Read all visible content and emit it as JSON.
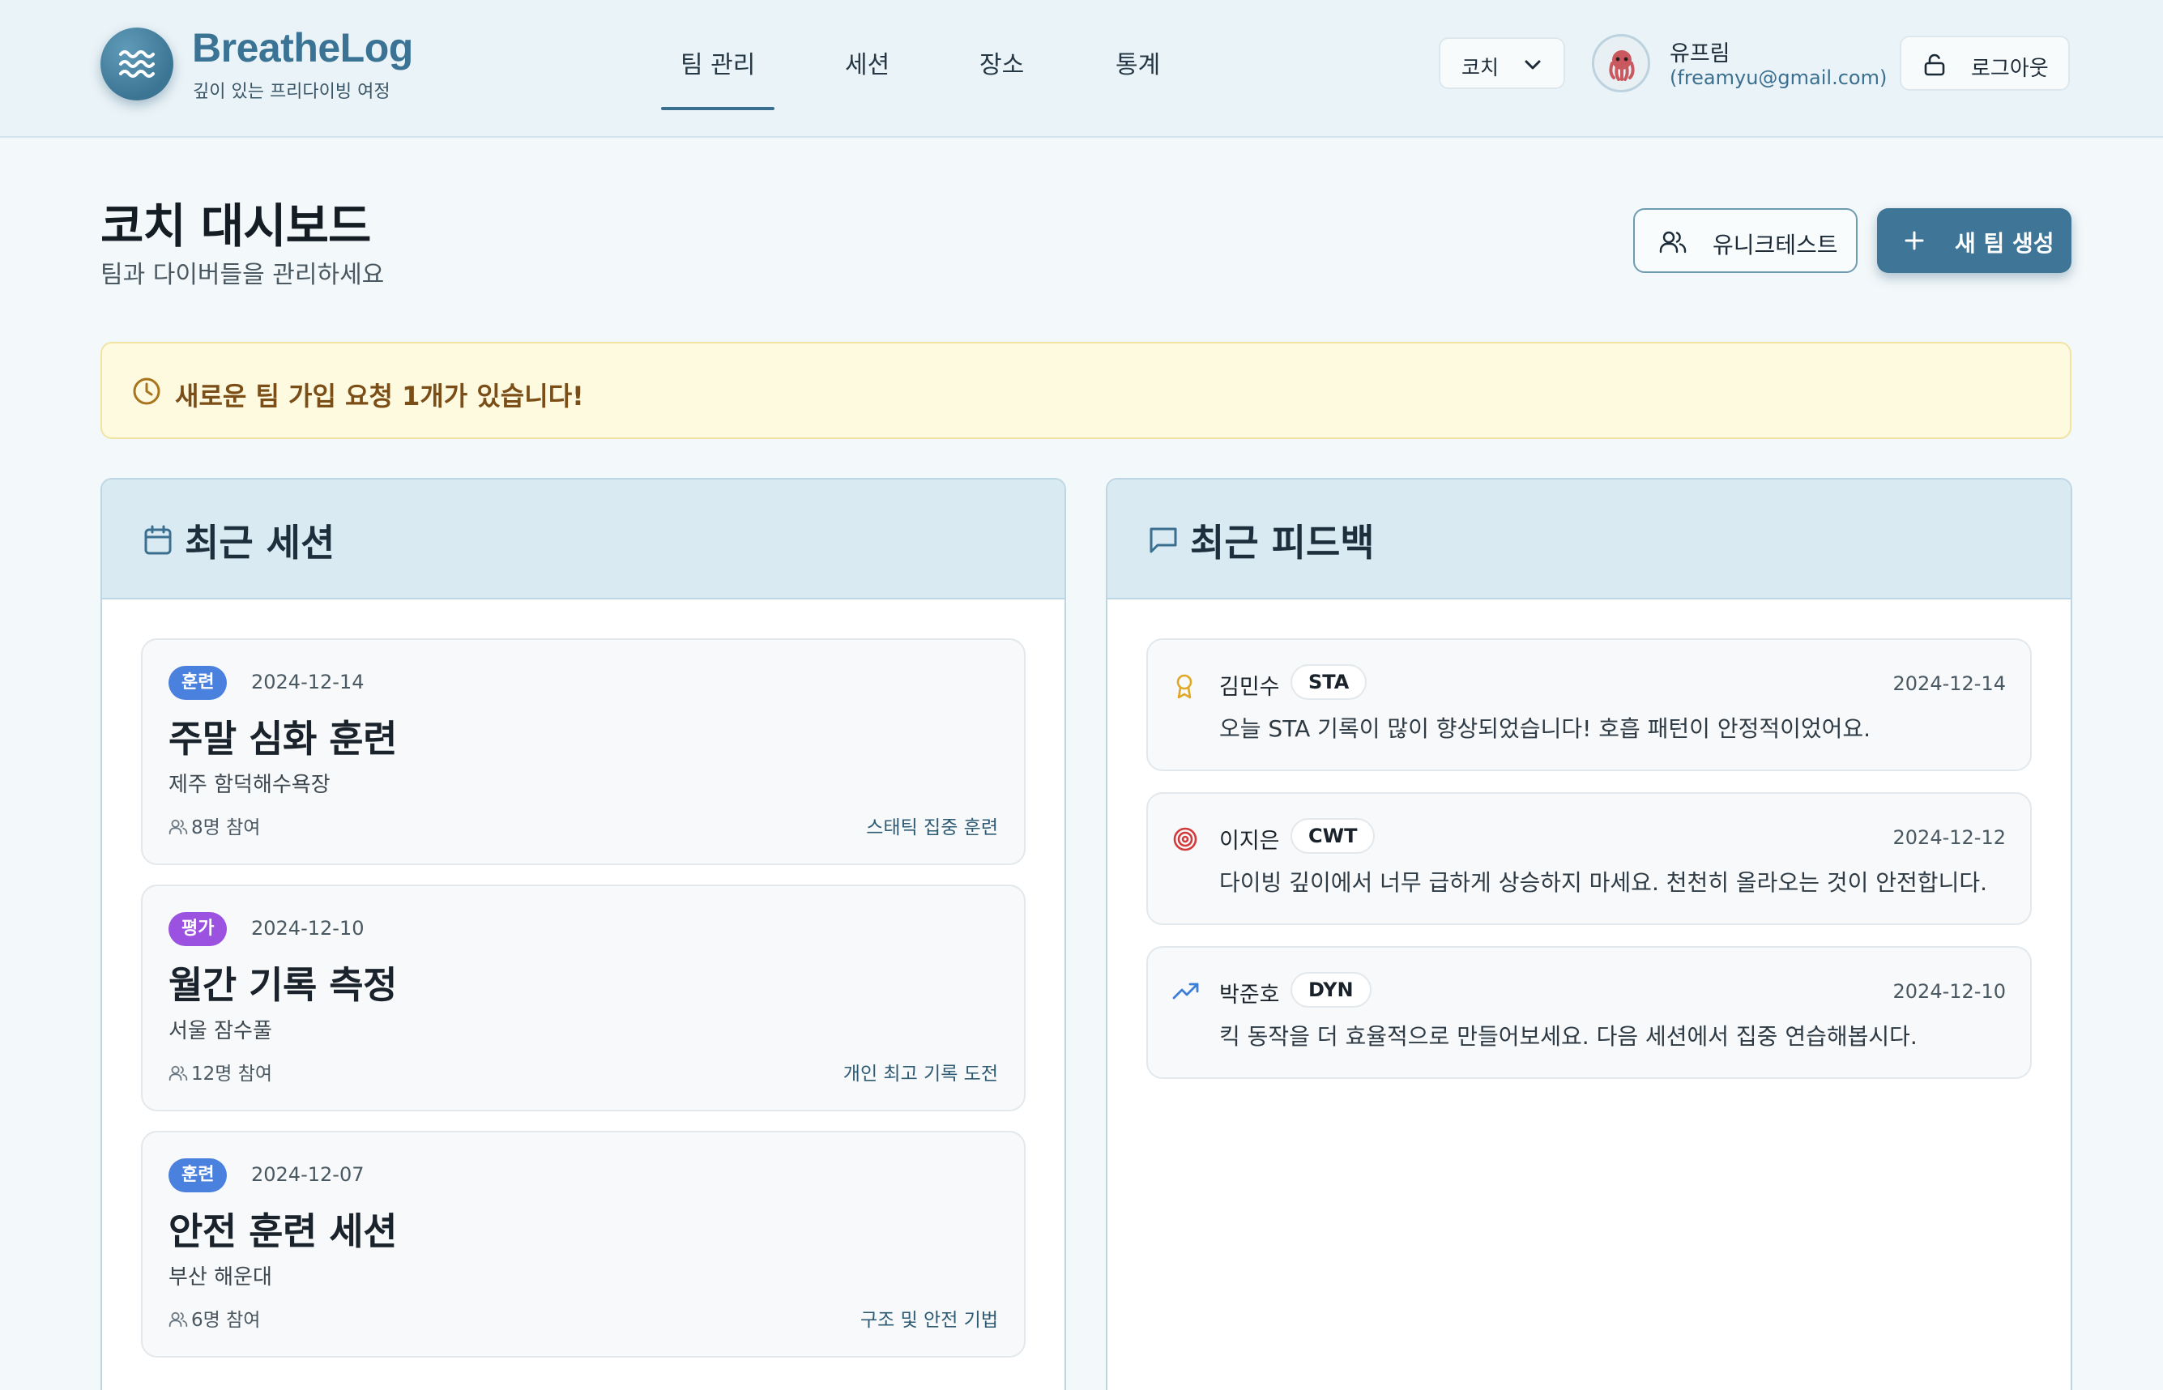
{
  "app": {
    "brand": "BreatheLog",
    "tagline": "깊이 있는 프리다이빙 여정"
  },
  "nav": {
    "tabs": [
      {
        "label": "팀 관리",
        "active": true
      },
      {
        "label": "세션",
        "active": false
      },
      {
        "label": "장소",
        "active": false
      },
      {
        "label": "통계",
        "active": false
      }
    ]
  },
  "header": {
    "role_select": {
      "value": "코치"
    },
    "user": {
      "name": "유프림",
      "email": "(freamyu@gmail.com)"
    },
    "logout_label": "로그아웃"
  },
  "page": {
    "title": "코치 대시보드",
    "subtitle": "팀과 다이버들을 관리하세요",
    "team_button": "유니크테스트",
    "create_button": "새 팀 생성"
  },
  "notice": {
    "text": "새로운 팀 가입 요청 1개가 있습니다!"
  },
  "sessions": {
    "title": "최근 세션",
    "items": [
      {
        "badge": "훈련",
        "badge_color": "#4a80de",
        "date": "2024-12-14",
        "title": "주말 심화 훈련",
        "location": "제주 함덕해수욕장",
        "participants": "8명 참여",
        "focus": "스태틱 집중 훈련"
      },
      {
        "badge": "평가",
        "badge_color": "#9b52e0",
        "date": "2024-12-10",
        "title": "월간 기록 측정",
        "location": "서울 잠수풀",
        "participants": "12명 참여",
        "focus": "개인 최고 기록 도전"
      },
      {
        "badge": "훈련",
        "badge_color": "#4a80de",
        "date": "2024-12-07",
        "title": "안전 훈련 세션",
        "location": "부산 해운대",
        "participants": "6명 참여",
        "focus": "구조 및 안전 기법"
      }
    ]
  },
  "feedback": {
    "title": "최근 피드백",
    "items": [
      {
        "icon": "award-icon",
        "icon_color": "#e0a826",
        "name": "김민수",
        "discipline": "STA",
        "date": "2024-12-14",
        "text": "오늘 STA 기록이 많이 향상되었습니다! 호흡 패턴이 안정적이었어요."
      },
      {
        "icon": "target-icon",
        "icon_color": "#d23b3b",
        "name": "이지은",
        "discipline": "CWT",
        "date": "2024-12-12",
        "text": "다이빙 깊이에서 너무 급하게 상승하지 마세요. 천천히 올라오는 것이 안전합니다."
      },
      {
        "icon": "trending-up-icon",
        "icon_color": "#3d7fd6",
        "name": "박준호",
        "discipline": "DYN",
        "date": "2024-12-10",
        "text": "킥 동작을 더 효율적으로 만들어보세요. 다음 세션에서 집중 연습해봅시다."
      }
    ]
  },
  "colors": {
    "primary": "#3f7596",
    "header_bg": "#eaf3f7",
    "panel_head_bg": "#d9eaf2",
    "notice_bg": "#fefadf",
    "notice_text": "#7b4d17"
  }
}
